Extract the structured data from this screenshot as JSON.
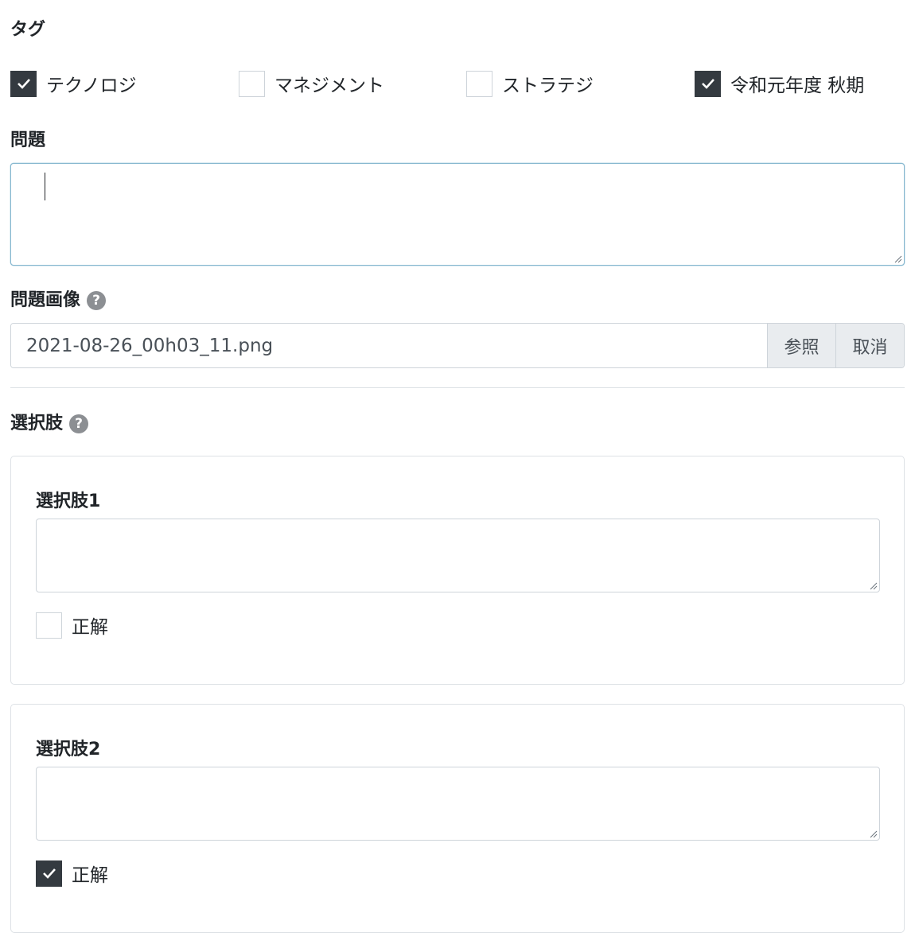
{
  "tags": {
    "label": "タグ",
    "options": [
      {
        "label": "テクノロジ",
        "checked": true
      },
      {
        "label": "マネジメント",
        "checked": false
      },
      {
        "label": "ストラテジ",
        "checked": false
      },
      {
        "label": "令和元年度 秋期",
        "checked": true
      }
    ]
  },
  "question": {
    "label": "問題",
    "value": ""
  },
  "question_image": {
    "label": "問題画像",
    "file_name": "2021-08-26_00h03_11.png",
    "browse_label": "参照",
    "cancel_label": "取消"
  },
  "choices": {
    "label": "選択肢",
    "items": [
      {
        "title": "選択肢1",
        "value": "",
        "correct_label": "正解",
        "correct": false
      },
      {
        "title": "選択肢2",
        "value": "",
        "correct_label": "正解",
        "correct": true
      }
    ]
  },
  "icons": {
    "help": "question-circle-icon",
    "check": "check-icon"
  },
  "colors": {
    "checkbox_checked": "#343a40",
    "focus_border": "#86b7cf",
    "button_bg": "#e9ecef"
  }
}
